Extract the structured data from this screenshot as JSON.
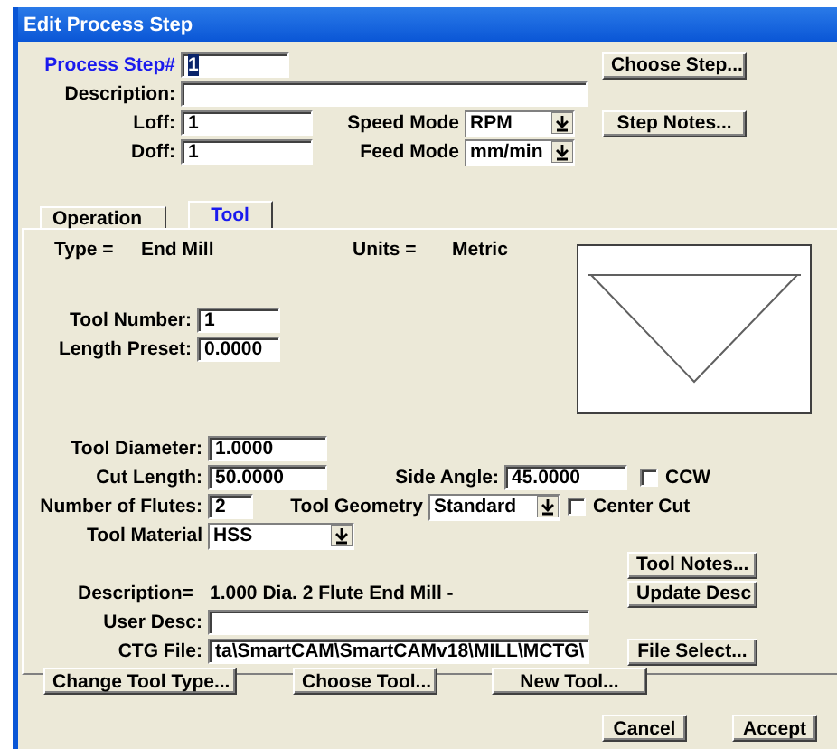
{
  "window": {
    "title": "Edit Process Step"
  },
  "header": {
    "process_step": {
      "label": "Process Step#",
      "value": "1"
    },
    "description": {
      "label": "Description:"
    },
    "loff": {
      "label": "Loff:",
      "value": "1"
    },
    "doff": {
      "label": "Doff:",
      "value": "1"
    },
    "speed_mode": {
      "label": "Speed Mode",
      "value": "RPM"
    },
    "feed_mode": {
      "label": "Feed Mode",
      "value": "mm/min"
    },
    "choose_step_button": "Choose Step...",
    "step_notes_button": "Step Notes..."
  },
  "tabs": [
    {
      "label": "Operation",
      "selected": false
    },
    {
      "label": "Tool",
      "selected": true
    }
  ],
  "tool": {
    "type_label": "Type =",
    "type_value": "End Mill",
    "units_label": "Units =",
    "units_value": "Metric",
    "tool_number": {
      "label": "Tool Number:",
      "value": "1"
    },
    "length_preset": {
      "label": "Length Preset:",
      "value": "0.0000"
    },
    "tool_diameter": {
      "label": "Tool Diameter:",
      "value": "1.0000"
    },
    "cut_length": {
      "label": "Cut Length:",
      "value": "50.0000"
    },
    "side_angle": {
      "label": "Side Angle:",
      "value": "45.0000"
    },
    "ccw": {
      "label": "CCW",
      "checked": false
    },
    "flutes": {
      "label": "Number of Flutes:",
      "value": "2"
    },
    "tool_geometry": {
      "label": "Tool Geometry",
      "value": "Standard"
    },
    "center_cut": {
      "label": "Center Cut",
      "checked": false
    },
    "tool_material": {
      "label": "Tool Material",
      "value": "HSS"
    },
    "tool_notes_button": "Tool Notes...",
    "description_label": "Description=",
    "description_value": "1.000 Dia. 2 Flute End Mill -",
    "update_desc_button": "Update Desc",
    "user_desc": {
      "label": "User Desc:"
    },
    "ctg_file": {
      "label": "CTG File:",
      "value": "ta\\SmartCAM\\SmartCAMv18\\MILL\\MCTG\\"
    },
    "file_select_button": "File Select...",
    "bottom_buttons": [
      "Change Tool Type...",
      "Choose Tool...",
      "New Tool..."
    ]
  },
  "footer_buttons": [
    "Cancel",
    "Accept"
  ]
}
